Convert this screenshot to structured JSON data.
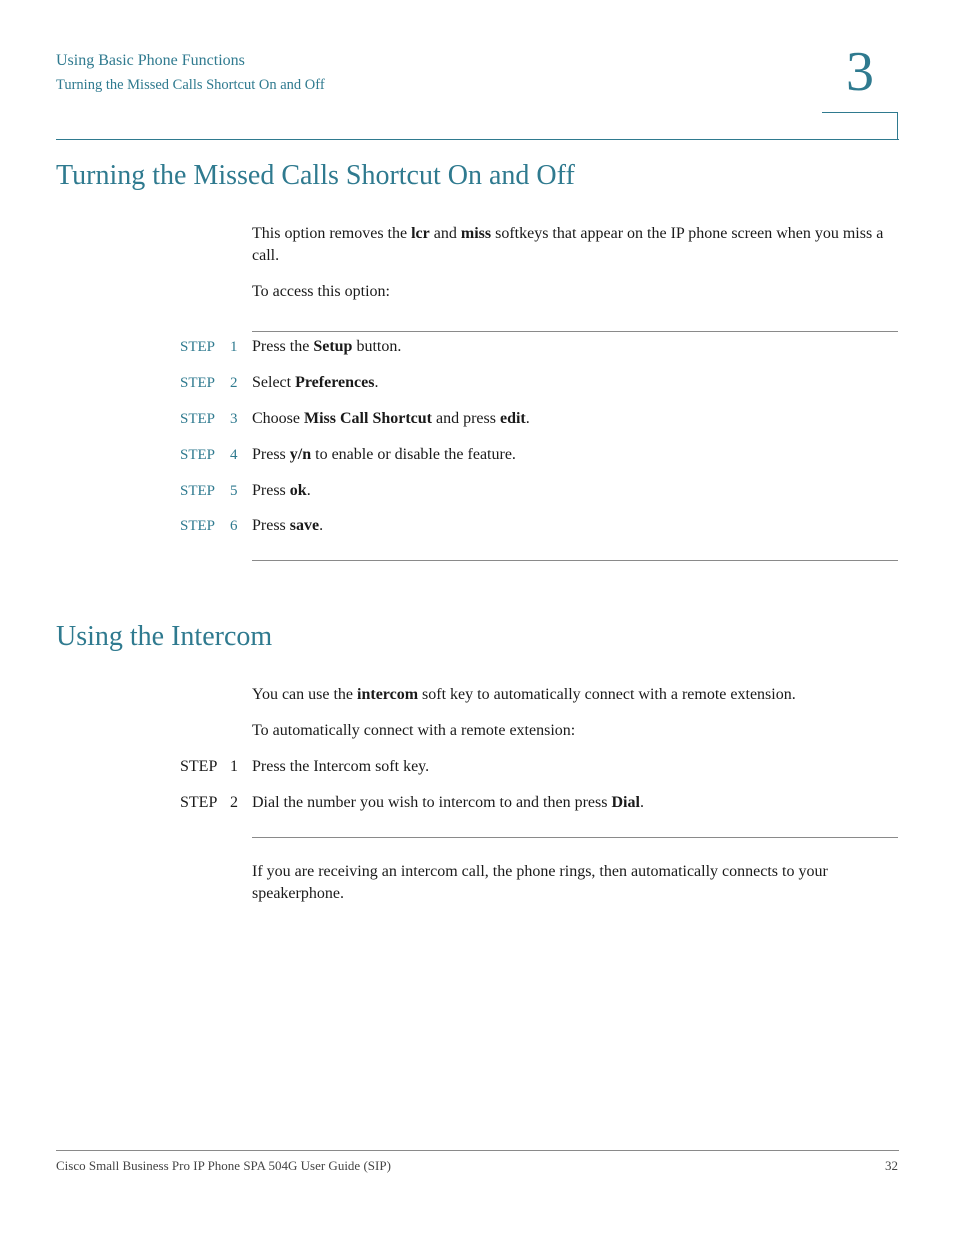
{
  "header": {
    "chapter_title": "Using Basic Phone Functions",
    "section_title": "Turning the Missed Calls Shortcut On and Off",
    "chapter_number": "3"
  },
  "section1": {
    "heading": "Turning the Missed Calls Shortcut On and Off",
    "intro": {
      "t1": "This option removes the ",
      "b1": "lcr",
      "t2": " and ",
      "b2": "miss",
      "t3": " softkeys that appear on the IP phone screen when you miss a call."
    },
    "access": "To access this option:",
    "step_label": "STEP",
    "steps": [
      {
        "num": "1",
        "pre": "Press the ",
        "bold": "Setup",
        "post": " button.",
        "bold2": "",
        "post2": ""
      },
      {
        "num": "2",
        "pre": "Select ",
        "bold": "Preferences",
        "post": ".",
        "bold2": "",
        "post2": ""
      },
      {
        "num": "3",
        "pre": "Choose ",
        "bold": "Miss Call Shortcut",
        "post": " and press ",
        "bold2": "edit",
        "post2": "."
      },
      {
        "num": "4",
        "pre": "Press ",
        "bold": "y/n",
        "post": " to enable or disable the feature.",
        "bold2": "",
        "post2": ""
      },
      {
        "num": "5",
        "pre": "Press ",
        "bold": "ok",
        "post": ".",
        "bold2": "",
        "post2": ""
      },
      {
        "num": "6",
        "pre": "Press ",
        "bold": "save",
        "post": ".",
        "bold2": "",
        "post2": ""
      }
    ]
  },
  "section2": {
    "heading": "Using the Intercom",
    "intro": {
      "t1": "You can use the ",
      "b1": "intercom",
      "t2": " soft key to automatically connect with a remote extension."
    },
    "connect": "To automatically connect with a remote extension:",
    "step_label": "STEP",
    "steps": [
      {
        "num": "1",
        "pre": "Press the Intercom soft key.",
        "bold": "",
        "post": ""
      },
      {
        "num": "2",
        "pre": "Dial the number you wish to intercom to and then press ",
        "bold": "Dial",
        "post": "."
      }
    ],
    "note": "If you are receiving an intercom call, the phone rings, then automatically connects to your speakerphone."
  },
  "footer": {
    "title": "Cisco Small Business Pro IP Phone SPA 504G User Guide (SIP)",
    "page": "32"
  }
}
